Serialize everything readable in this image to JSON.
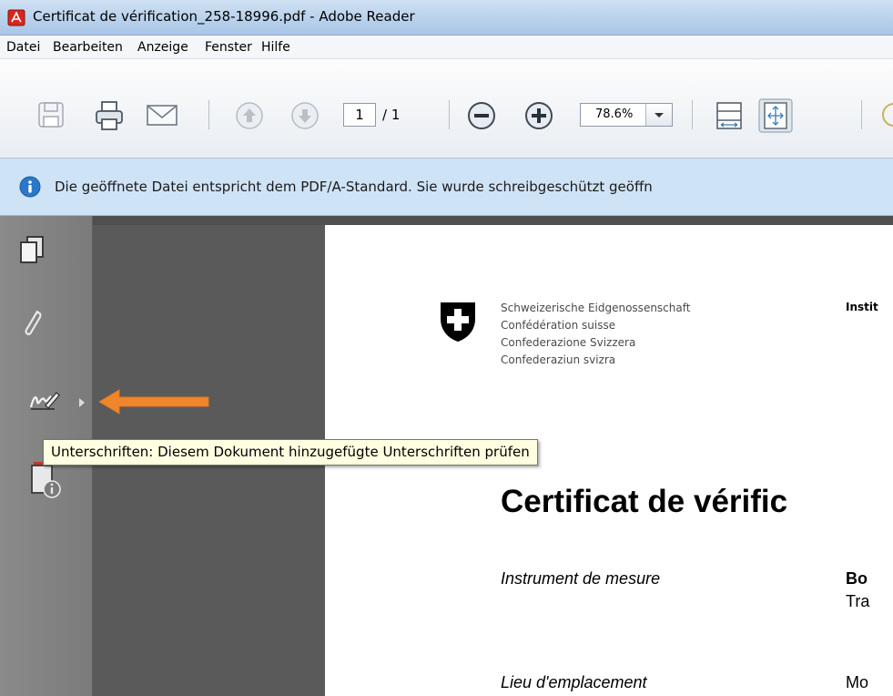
{
  "window": {
    "title": "Certificat de vérification_258-18996.pdf - Adobe Reader"
  },
  "menu": [
    "Datei",
    "Bearbeiten",
    "Anzeige",
    "Fenster",
    "Hilfe"
  ],
  "toolbar": {
    "icons": [
      "save-icon",
      "print-icon",
      "email-icon",
      "page-up-icon",
      "page-down-icon",
      "zoom-out-icon",
      "zoom-in-icon",
      "fit-width-icon",
      "fit-page-icon"
    ],
    "page_number": "1",
    "page_total": "/ 1",
    "zoom": "78.6%"
  },
  "infobar": {
    "message": "Die geöffnete Datei entspricht dem PDF/A-Standard. Sie wurde schreibgeschützt geöffn"
  },
  "leftnav": {
    "icons": [
      "pages-icon",
      "attachment-icon",
      "signature-icon",
      "document-info-icon"
    ]
  },
  "tooltip": {
    "text": "Unterschriften: Diesem Dokument hinzugefügte Unterschriften prüfen"
  },
  "document": {
    "confederation": [
      "Schweizerische Eidgenossenschaft",
      "Confédération suisse",
      "Confederazione Svizzera",
      "Confederaziun svizra"
    ],
    "institute": "Instit",
    "title": "Certificat de vérific",
    "fields": [
      {
        "label": "Instrument de mesure",
        "value_1": "Bo",
        "value_2": "Tra"
      },
      {
        "label": "Lieu d'emplacement",
        "value_1": "Mo"
      }
    ]
  },
  "colors": {
    "arrow": "#f0862c",
    "infobar": "#cfe3f7",
    "tooltip_bg": "#ffffe1",
    "nav_panel": "#7f7f7f",
    "doc_background": "#5a5a5a"
  }
}
